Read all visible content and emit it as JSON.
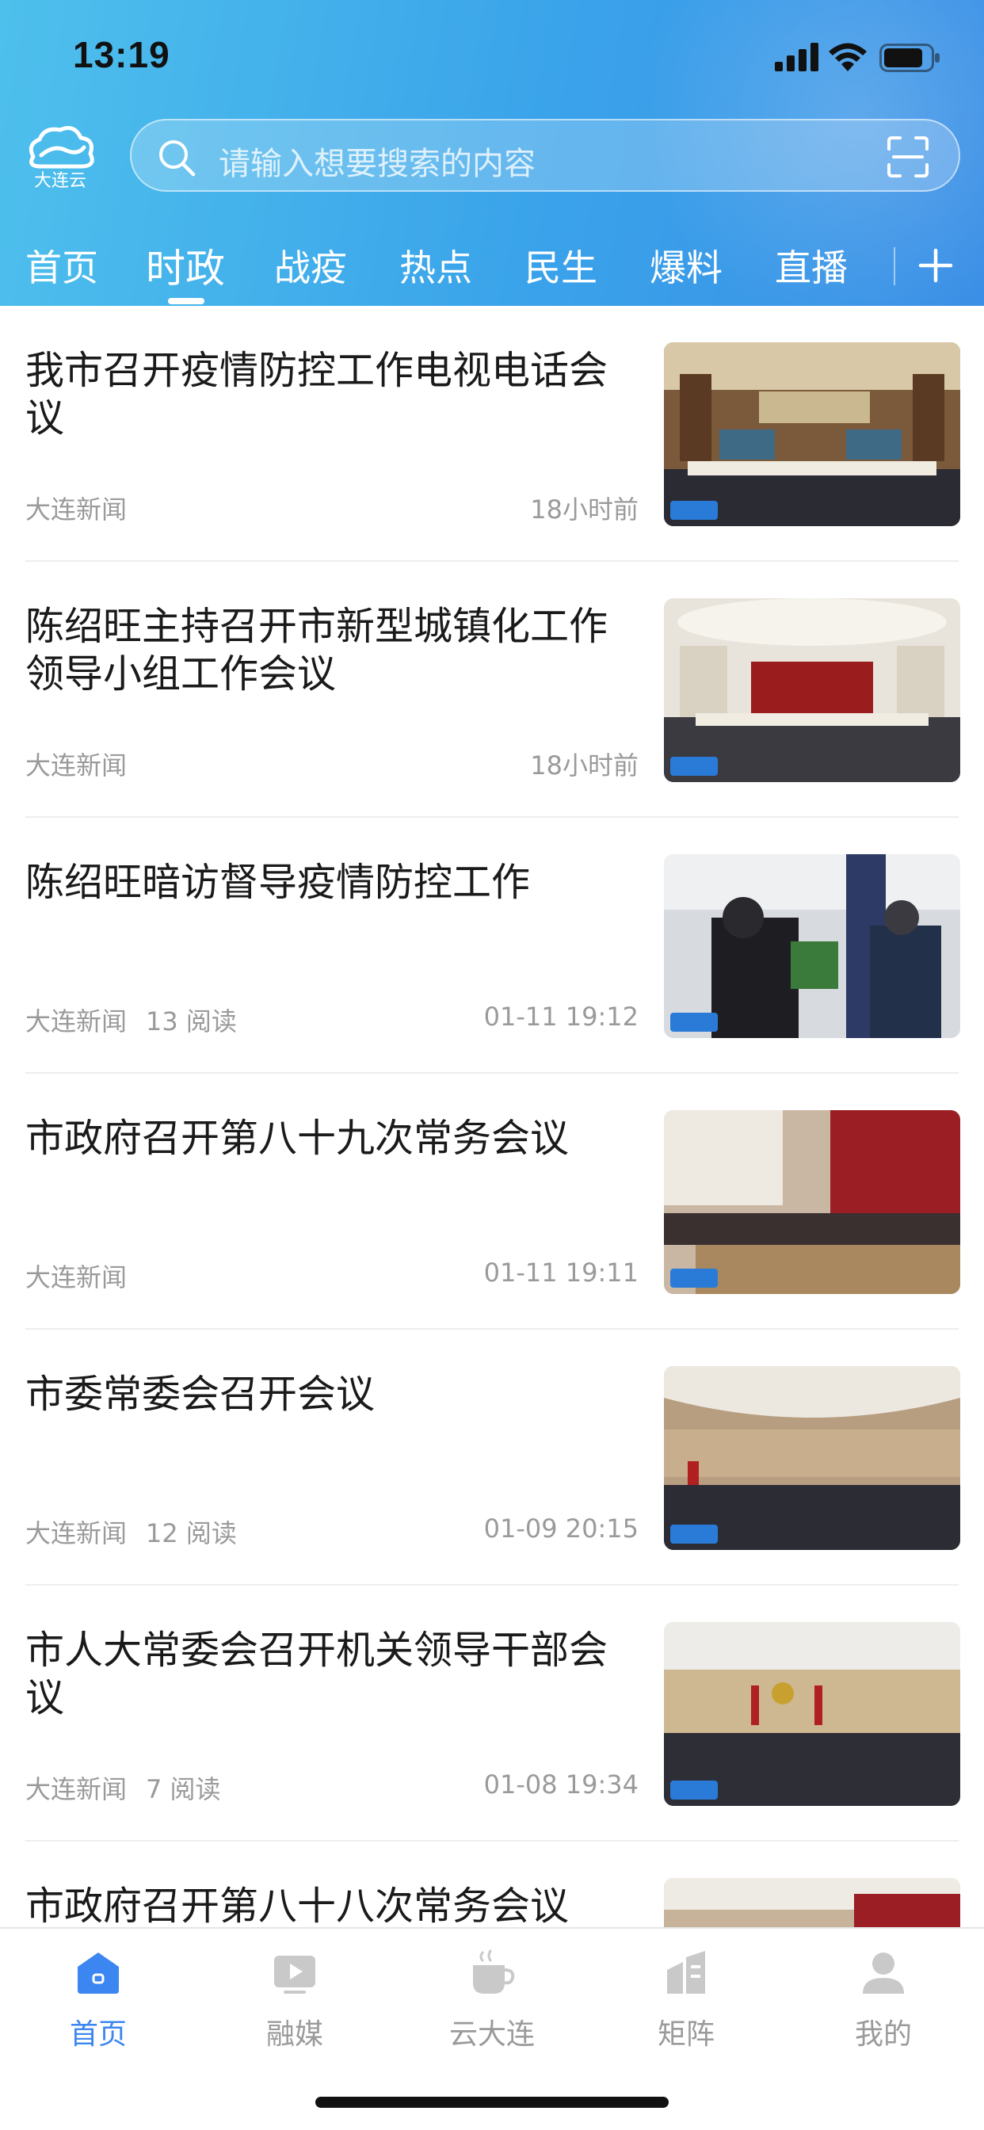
{
  "status_bar": {
    "time": "13:19"
  },
  "header": {
    "logo_text": "大连云",
    "search_placeholder": "请输入想要搜索的内容",
    "tabs": [
      {
        "label": "首页",
        "active": false
      },
      {
        "label": "时政",
        "active": true
      },
      {
        "label": "战疫",
        "active": false
      },
      {
        "label": "热点",
        "active": false
      },
      {
        "label": "民生",
        "active": false
      },
      {
        "label": "爆料",
        "active": false
      },
      {
        "label": "直播",
        "active": false
      }
    ]
  },
  "news": [
    {
      "title": "我市召开疫情防控工作电视电话会议",
      "source": "大连新闻",
      "reads": "",
      "time": "18小时前"
    },
    {
      "title": "陈绍旺主持召开市新型城镇化工作领导小组工作会议",
      "source": "大连新闻",
      "reads": "",
      "time": "18小时前"
    },
    {
      "title": "陈绍旺暗访督导疫情防控工作",
      "source": "大连新闻",
      "reads": "13 阅读",
      "time": "01-11 19:12"
    },
    {
      "title": "市政府召开第八十九次常务会议",
      "source": "大连新闻",
      "reads": "",
      "time": "01-11 19:11"
    },
    {
      "title": "市委常委会召开会议",
      "source": "大连新闻",
      "reads": "12 阅读",
      "time": "01-09 20:15"
    },
    {
      "title": "市人大常委会召开机关领导干部会议",
      "source": "大连新闻",
      "reads": "7 阅读",
      "time": "01-08 19:34"
    },
    {
      "title": "市政府召开第八十八次常务会议",
      "source": "",
      "reads": "",
      "time": ""
    }
  ],
  "tab_bar": {
    "items": [
      {
        "label": "首页",
        "icon": "home-icon",
        "active": true
      },
      {
        "label": "融媒",
        "icon": "video-icon",
        "active": false
      },
      {
        "label": "云大连",
        "icon": "cup-icon",
        "active": false
      },
      {
        "label": "矩阵",
        "icon": "buildings-icon",
        "active": false
      },
      {
        "label": "我的",
        "icon": "person-icon",
        "active": false
      }
    ]
  },
  "colors": {
    "accent": "#3b86f0",
    "header_start": "#4ec0ec",
    "header_end": "#3b8fe6",
    "muted": "#9a9a9a"
  }
}
